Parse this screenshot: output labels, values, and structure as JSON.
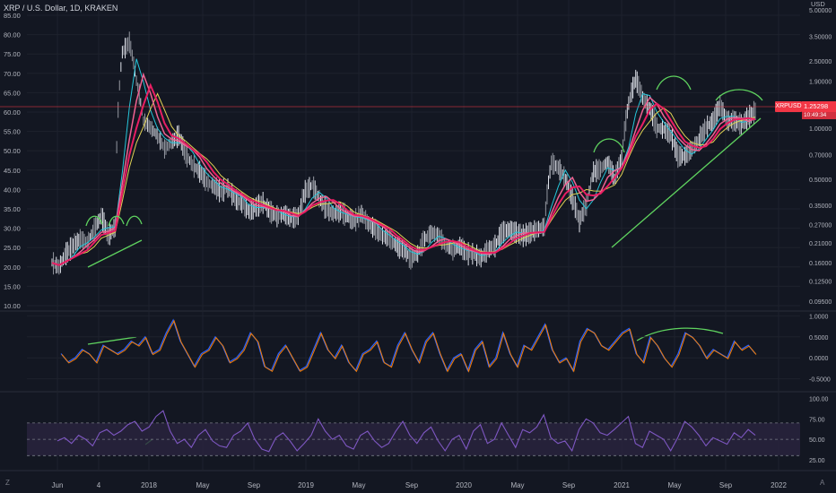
{
  "header": {
    "title": "XRP / U.S. Dollar, 1D, KRAKEN",
    "currency": "USD"
  },
  "price_tag": {
    "symbol": "XRPUSD",
    "price": "1.25298",
    "countdown": "10:49:34"
  },
  "buttons": {
    "z": "Z",
    "a": "A"
  },
  "colors": {
    "background": "#131722",
    "grid": "#1e222d",
    "price_bars": "#b2b5be",
    "ma_red": "#e91e63",
    "ma_pink": "#f06292",
    "ma_yellow": "#e0d255",
    "ma_cyan": "#26c6da",
    "annotation": "#5fd35f",
    "osc_orange": "#f57c00",
    "osc_blue": "#2962ff",
    "rsi_purple": "#7e57c2",
    "rsi_band": "#2a2440",
    "price_line": "#f23645"
  },
  "chart_data": [
    {
      "type": "line",
      "panel": "price",
      "title": "XRP / U.S. Dollar, 1D, KRAKEN",
      "x_ticks": [
        "Jun",
        "4",
        "2018",
        "May",
        "Sep",
        "2019",
        "May",
        "Sep",
        "2020",
        "May",
        "Sep",
        "2021",
        "May",
        "Sep",
        "2022"
      ],
      "left_axis_ticks": [
        "85.00",
        "80.00",
        "75.00",
        "70.00",
        "65.00",
        "60.00",
        "55.00",
        "50.00",
        "45.00",
        "40.00",
        "35.00",
        "30.00",
        "25.00",
        "20.00",
        "15.00",
        "10.00"
      ],
      "right_axis_ticks": [
        "5.00000",
        "3.50000",
        "2.50000",
        "1.90000",
        "1.40000",
        "1.00000",
        "0.70000",
        "0.50000",
        "0.35000",
        "0.27000",
        "0.21000",
        "0.16000",
        "0.12500",
        "0.09500"
      ],
      "scale": "log",
      "series": [
        {
          "values": [
            0.16,
            0.15,
            0.18,
            0.2,
            0.22,
            0.21,
            0.25,
            0.3,
            0.23,
            0.26,
            2.8,
            3.2,
            1.9,
            1.1,
            1.0,
            0.9,
            0.75,
            0.82,
            0.9,
            0.7,
            0.6,
            0.55,
            0.48,
            0.45,
            0.42,
            0.44,
            0.38,
            0.36,
            0.32,
            0.34,
            0.36,
            0.32,
            0.3,
            0.31,
            0.29,
            0.3,
            0.42,
            0.46,
            0.38,
            0.33,
            0.31,
            0.32,
            0.3,
            0.28,
            0.31,
            0.27,
            0.25,
            0.23,
            0.22,
            0.2,
            0.19,
            0.17,
            0.18,
            0.22,
            0.24,
            0.23,
            0.2,
            0.19,
            0.2,
            0.18,
            0.18,
            0.17,
            0.19,
            0.2,
            0.24,
            0.25,
            0.24,
            0.23,
            0.24,
            0.25,
            0.26,
            0.62,
            0.58,
            0.5,
            0.38,
            0.28,
            0.35,
            0.55,
            0.57,
            0.63,
            0.5,
            0.66,
            1.4,
            1.95,
            1.5,
            1.3,
            1.0,
            0.98,
            0.9,
            0.68,
            0.68,
            0.75,
            0.85,
            1.0,
            1.1,
            1.35,
            1.1,
            1.1,
            1.05,
            1.15,
            1.25
          ]
        }
      ]
    },
    {
      "type": "line",
      "panel": "oscillator",
      "y_ticks": [
        "1.0000",
        "0.5000",
        "0.0000",
        "-0.5000"
      ],
      "series": [
        {
          "values": [
            0.1,
            -0.1,
            0.0,
            0.2,
            0.1,
            -0.1,
            0.3,
            0.2,
            0.1,
            0.2,
            0.4,
            0.3,
            0.5,
            0.1,
            0.2,
            0.6,
            0.9,
            0.4,
            0.1,
            -0.2,
            0.1,
            0.2,
            0.5,
            0.3,
            -0.1,
            0.0,
            0.2,
            0.6,
            0.4,
            -0.2,
            -0.3,
            0.1,
            0.3,
            0.0,
            -0.3,
            -0.2,
            0.2,
            0.6,
            0.2,
            0.0,
            0.3,
            -0.1,
            -0.3,
            0.1,
            0.2,
            0.4,
            -0.1,
            -0.2,
            0.3,
            0.6,
            0.2,
            -0.1,
            0.4,
            0.6,
            0.1,
            -0.3,
            0.0,
            0.1,
            -0.3,
            0.2,
            0.4,
            -0.2,
            0.0,
            0.6,
            0.1,
            -0.2,
            0.3,
            0.2,
            0.5,
            0.8,
            0.2,
            -0.1,
            0.0,
            -0.3,
            0.4,
            0.7,
            0.6,
            0.3,
            0.2,
            0.4,
            0.6,
            0.7,
            0.1,
            -0.1,
            0.5,
            0.3,
            0.0,
            -0.2,
            0.1,
            0.6,
            0.5,
            0.3,
            0.0,
            0.2,
            0.1,
            0.0,
            0.4,
            0.2,
            0.3,
            0.1
          ]
        }
      ]
    },
    {
      "type": "line",
      "panel": "rsi",
      "y_ticks": [
        "100.00",
        "75.00",
        "50.00",
        "25.00"
      ],
      "band": [
        30,
        70
      ],
      "series": [
        {
          "values": [
            48,
            52,
            45,
            55,
            50,
            42,
            58,
            62,
            55,
            60,
            68,
            72,
            60,
            65,
            78,
            85,
            60,
            45,
            50,
            40,
            55,
            62,
            48,
            42,
            40,
            55,
            60,
            70,
            50,
            38,
            35,
            52,
            58,
            48,
            36,
            45,
            55,
            75,
            60,
            50,
            55,
            42,
            38,
            55,
            60,
            48,
            40,
            45,
            60,
            72,
            55,
            45,
            58,
            65,
            48,
            36,
            50,
            55,
            38,
            60,
            68,
            45,
            50,
            70,
            55,
            40,
            62,
            58,
            65,
            80,
            52,
            45,
            48,
            36,
            62,
            75,
            70,
            58,
            55,
            62,
            70,
            78,
            45,
            40,
            60,
            55,
            50,
            36,
            52,
            72,
            65,
            55,
            42,
            52,
            48,
            44,
            58,
            52,
            62,
            55
          ]
        }
      ]
    }
  ]
}
